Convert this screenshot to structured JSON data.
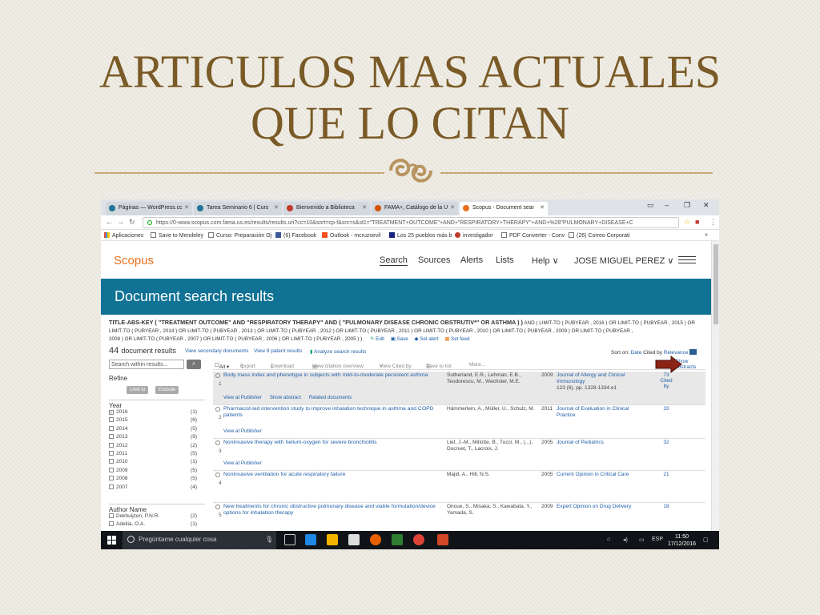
{
  "slide": {
    "title_line1": "ARTICULOS MAS ACTUALES",
    "title_line2": "QUE LO CITAN"
  },
  "browser": {
    "tabs": [
      {
        "label": "Páginas — WordPress.cc",
        "icon": "wordpress-icon"
      },
      {
        "label": "Tarea Seminario 6 | Curs",
        "icon": "wordpress-icon"
      },
      {
        "label": "Bienvenido a Biblioteca",
        "icon": "library-icon"
      },
      {
        "label": "FAMA+, Catálogo de la U",
        "icon": "fama-icon"
      },
      {
        "label": "Scopus - Document sear",
        "icon": "scopus-icon"
      }
    ],
    "url": "https://0-www.scopus.com.fama.us.es/results/results.uri?cc=10&sort=cp-f&src=s&st1=\"TREATMENT+OUTCOME\"+AND+\"RESPIRATORY+THERAPY\"+AND+%28\"PULMONARY+DISEASE+C",
    "bookmarks": [
      "Aplicaciones",
      "Save to Mendeley",
      "Curso: Preparación Oj",
      "(6) Facebook",
      "Outlook - mcruzsevil",
      "Los 25 pueblos más b",
      "investigador",
      "PDF Converter - Conv",
      "(26) Correo Corporati"
    ],
    "more": "»"
  },
  "scopus": {
    "logo": "Scopus",
    "nav": [
      "Search",
      "Sources",
      "Alerts",
      "Lists",
      "Help ∨",
      "JOSE MIGUEL PEREZ ∨"
    ],
    "banner": "Document search results",
    "query_bold": "TITLE-ABS-KEY ( \"TREATMENT OUTCOME\" AND \"RESPIRATORY THERAPY\" AND ( \"PULMONARY DISEASE CHRONIC OBSTRUTIV*\" OR asthma ) )",
    "query_rest1": " AND ( LIMIT-TO ( PUBYEAR , 2016 ) OR LIMIT-TO ( PUBYEAR , 2015 ) OR",
    "query_line2": "LIMIT-TO ( PUBYEAR , 2014 ) OR LIMIT-TO ( PUBYEAR , 2013 ) OR LIMIT-TO ( PUBYEAR , 2012 ) OR LIMIT-TO ( PUBYEAR , 2011 ) OR LIMIT-TO ( PUBYEAR , 2010 ) OR LIMIT-TO ( PUBYEAR , 2009 ) OR LIMIT-TO ( PUBYEAR ,",
    "query_line3": "2008 ) OR LIMIT-TO ( PUBYEAR , 2007 ) OR LIMIT-TO ( PUBYEAR , 2006 ) OR LIMIT-TO ( PUBYEAR , 2005 ) )",
    "query_actions": [
      "Edit",
      "Save",
      "Set alert",
      "Set feed"
    ],
    "results_count": "44",
    "results_label": "document results",
    "result_links": [
      "View secondary documents",
      "View 9 patent results",
      "Analyze search results"
    ],
    "sort_label": "Sort on:",
    "sort_options": [
      "Date",
      "Cited by",
      "Relevance"
    ],
    "show_abstracts": "Show abstracts",
    "search_within": "Search within results...",
    "refine": "Refine",
    "limit_to": "Limit to",
    "exclude": "Exclude",
    "year_heading": "Year",
    "years": [
      {
        "year": "2016",
        "count": "(1)",
        "checked": true
      },
      {
        "year": "2015",
        "count": "(6)",
        "checked": false
      },
      {
        "year": "2014",
        "count": "(5)",
        "checked": false
      },
      {
        "year": "2013",
        "count": "(9)",
        "checked": false
      },
      {
        "year": "2012",
        "count": "(2)",
        "checked": false
      },
      {
        "year": "2011",
        "count": "(5)",
        "checked": false
      },
      {
        "year": "2010",
        "count": "(1)",
        "checked": false
      },
      {
        "year": "2009",
        "count": "(5)",
        "checked": false
      },
      {
        "year": "2008",
        "count": "(5)",
        "checked": false
      },
      {
        "year": "2007",
        "count": "(4)",
        "checked": false
      }
    ],
    "author_heading": "Author Name",
    "authors": [
      {
        "name": "Dekhuijzen, P.N.R.",
        "count": "(2)"
      },
      {
        "name": "Adeilia, O.A.",
        "count": "(1)"
      }
    ],
    "toolbar": [
      "All ▾",
      "Export",
      "Download",
      "View citation overview",
      "View Cited by",
      "Save to list",
      "More..."
    ],
    "records": [
      {
        "num": "1",
        "title": "Body mass index and phenotype in subjects with mild-to-moderate persistent asthma",
        "authors": "Sutherland, E.R., Lehman, E.B., Teodorescu, M., Wechsler, M.E.",
        "year": "2009",
        "source": "Journal of Allergy and Clinical Immunology",
        "volume": "123 (6), pp. 1328-1334.e1",
        "cited": "73",
        "cited_label": "Cited by",
        "links": [
          "View at Publisher",
          "Show abstract",
          "Related documents"
        ]
      },
      {
        "num": "2",
        "title": "Pharmacist-led intervention study to improve inhalation technique in asthma and COPD patients",
        "authors": "Hämmerlein, A., Müller, U., Schulz, M.",
        "year": "2011",
        "source": "Journal of Evaluation in Clinical Practice",
        "volume": "",
        "cited": "33",
        "cited_label": "",
        "links": [
          "View at Publisher"
        ]
      },
      {
        "num": "3",
        "title": "Noninvasive therapy with helium-oxygen for severe bronchiolitis",
        "authors": "Liet, J.-M., Millotte, B., Tucci, M., (...), Ducruet, T., Lacroix, J.",
        "year": "2005",
        "source": "Journal of Pediatrics",
        "volume": "",
        "cited": "32",
        "cited_label": "",
        "links": [
          "View at Publisher"
        ]
      },
      {
        "num": "4",
        "title": "Noninvasive ventilation for acute respiratory failure",
        "authors": "Majid, A., Hill, N.S.",
        "year": "2005",
        "source": "Current Opinion in Critical Care",
        "volume": "",
        "cited": "21",
        "cited_label": "",
        "links": []
      },
      {
        "num": "5",
        "title": "New treatments for chronic obstructive pulmonary disease and viable formulation/device options for inhalation therapy",
        "authors": "Onoue, S., Misaka, S., Kawabata, Y., Yamada, S.",
        "year": "2009",
        "source": "Expert Opinion on Drug Delivery",
        "volume": "",
        "cited": "18",
        "cited_label": "",
        "links": []
      }
    ]
  },
  "taskbar": {
    "search_placeholder": "Pregúntame cualquier cosa",
    "lang": "ESP",
    "time": "11:50",
    "date": "17/12/2016"
  }
}
